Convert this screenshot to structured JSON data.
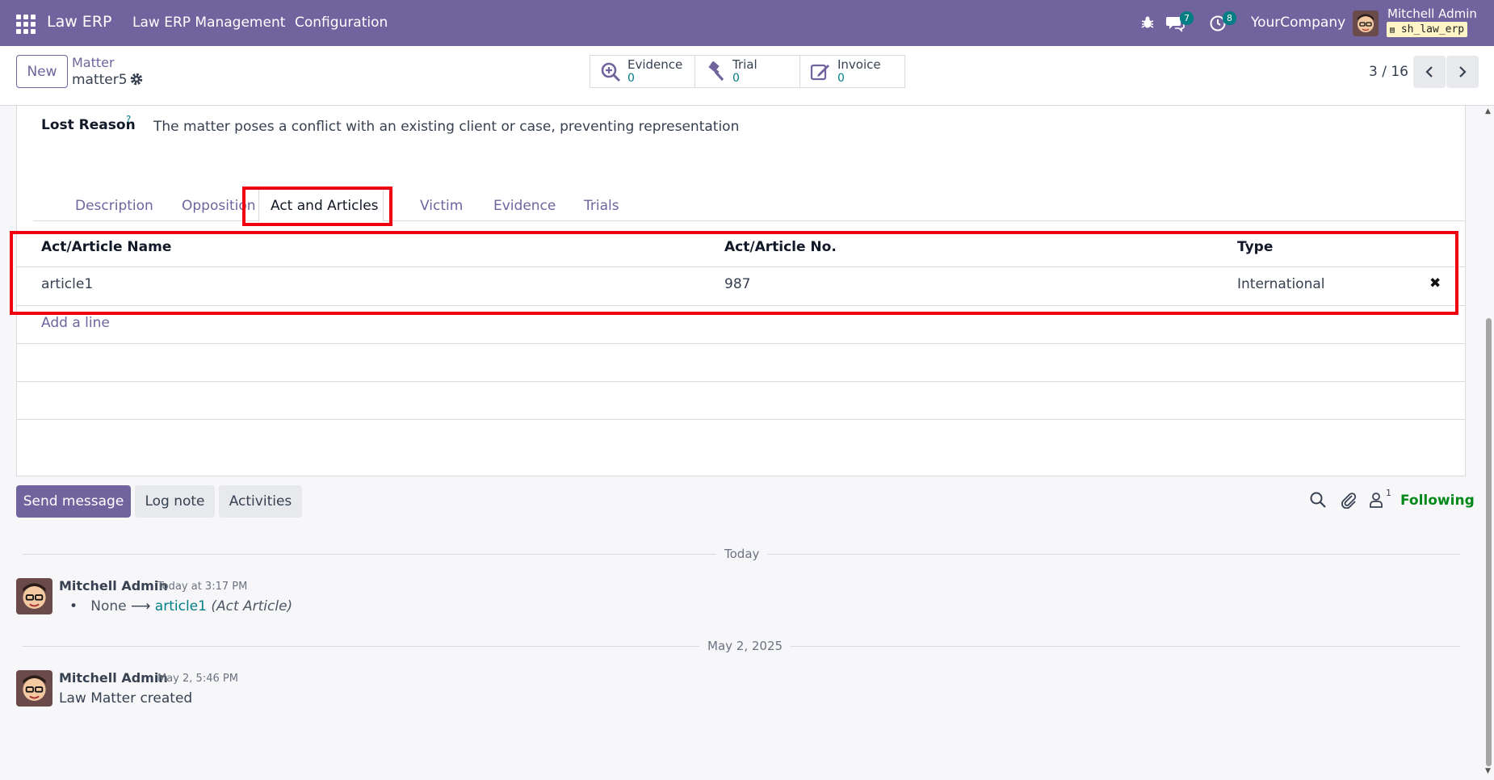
{
  "navbar": {
    "brand": "Law ERP",
    "menus": [
      "Law ERP Management",
      "Configuration"
    ],
    "messages_count": "7",
    "activities_count": "8",
    "company": "YourCompany",
    "user_name": "Mitchell Admin",
    "db_name": "sh_law_erp"
  },
  "control": {
    "new_label": "New",
    "breadcrumb_parent": "Matter",
    "breadcrumb_current": "matter5",
    "smart_buttons": [
      {
        "label": "Evidence",
        "value": "0",
        "icon": "magnifier-plus-icon"
      },
      {
        "label": "Trial",
        "value": "0",
        "icon": "gavel-icon"
      },
      {
        "label": "Invoice",
        "value": "0",
        "icon": "edit-icon"
      }
    ],
    "pager": "3 / 16"
  },
  "form": {
    "lost_reason_label": "Lost Reason",
    "lost_reason_help": "?",
    "lost_reason_value": "The matter poses a conflict with an existing client or case, preventing representation",
    "tabs": [
      "Description",
      "Opposition",
      "Act and Articles",
      "Victim",
      "Evidence",
      "Trials"
    ],
    "active_tab": "Act and Articles",
    "table": {
      "headers": [
        "Act/Article Name",
        "Act/Article No.",
        "Type"
      ],
      "rows": [
        {
          "name": "article1",
          "number": "987",
          "type": "International"
        }
      ],
      "add_line": "Add a line"
    }
  },
  "chatter": {
    "send_message": "Send message",
    "log_note": "Log note",
    "activities": "Activities",
    "followers_count": "1",
    "following": "Following",
    "groups": [
      {
        "date": "Today",
        "author": "Mitchell Admin",
        "time": "Today at 3:17 PM",
        "change_old": "None",
        "change_arrow": "⟶",
        "change_new": "article1",
        "change_field": "(Act Article)"
      },
      {
        "date": "May 2, 2025",
        "author": "Mitchell Admin",
        "time": "May 2, 5:46 PM",
        "body": "Law Matter created"
      }
    ]
  },
  "colors": {
    "brand": "#71639e",
    "accent": "#017e84",
    "highlight": "#ee0010",
    "following": "#008818"
  }
}
